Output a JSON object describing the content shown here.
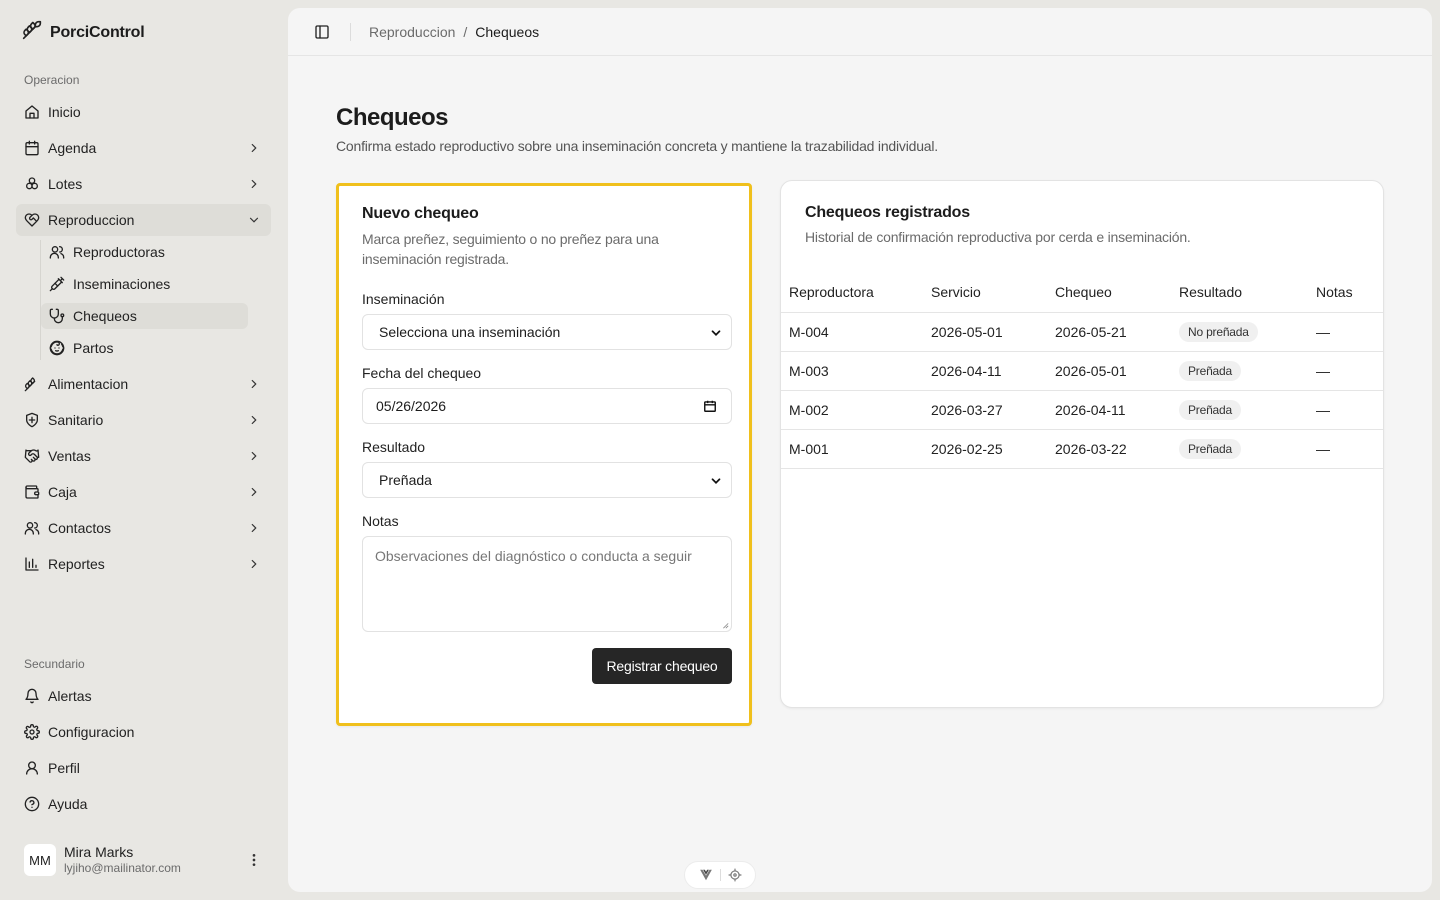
{
  "app": {
    "name": "PorciControl"
  },
  "sidebar": {
    "section_main": "Operacion",
    "items": [
      {
        "label": "Inicio",
        "icon": "home-icon"
      },
      {
        "label": "Agenda",
        "icon": "calendar-icon"
      },
      {
        "label": "Lotes",
        "icon": "boxes-icon"
      },
      {
        "label": "Reproduccion",
        "icon": "heart-handshake-icon"
      },
      {
        "label": "Alimentacion",
        "icon": "wheat-icon"
      },
      {
        "label": "Sanitario",
        "icon": "shield-icon"
      },
      {
        "label": "Ventas",
        "icon": "handshake-icon"
      },
      {
        "label": "Caja",
        "icon": "wallet-icon"
      },
      {
        "label": "Contactos",
        "icon": "users-icon"
      },
      {
        "label": "Reportes",
        "icon": "bar-chart-icon"
      }
    ],
    "subitems": [
      {
        "label": "Reproductoras",
        "icon": "users-icon"
      },
      {
        "label": "Inseminaciones",
        "icon": "syringe-icon"
      },
      {
        "label": "Chequeos",
        "icon": "stethoscope-icon"
      },
      {
        "label": "Partos",
        "icon": "baby-icon"
      }
    ],
    "section_secondary": "Secundario",
    "secondary": [
      {
        "label": "Alertas",
        "icon": "bell-icon"
      },
      {
        "label": "Configuracion",
        "icon": "gear-icon"
      },
      {
        "label": "Perfil",
        "icon": "user-icon"
      },
      {
        "label": "Ayuda",
        "icon": "help-icon"
      }
    ],
    "user": {
      "initials": "MM",
      "name": "Mira Marks",
      "email": "lyjiho@mailinator.com"
    }
  },
  "breadcrumb": {
    "parent": "Reproduccion",
    "separator": "/",
    "current": "Chequeos"
  },
  "page": {
    "title": "Chequeos",
    "description": "Confirma estado reproductivo sobre una inseminación concreta y mantiene la trazabilidad individual."
  },
  "form": {
    "title": "Nuevo chequeo",
    "description": "Marca preñez, seguimiento o no preñez para una inseminación registrada.",
    "insemination_label": "Inseminación",
    "insemination_value": "Selecciona una inseminación",
    "date_label": "Fecha del chequeo",
    "date_value": "05/26/2026",
    "result_label": "Resultado",
    "result_value": "Preñada",
    "notes_label": "Notas",
    "notes_placeholder": "Observaciones del diagnóstico o conducta a seguir",
    "submit_label": "Registrar chequeo",
    "highlight_color": "#f0c01c"
  },
  "records": {
    "title": "Chequeos registrados",
    "description": "Historial de confirmación reproductiva por cerda e inseminación.",
    "columns": [
      "Reproductora",
      "Servicio",
      "Chequeo",
      "Resultado",
      "Notas"
    ],
    "rows": [
      [
        "M-004",
        "2026-05-01",
        "2026-05-21",
        "No preñada",
        "—"
      ],
      [
        "M-003",
        "2026-04-11",
        "2026-05-01",
        "Preñada",
        "—"
      ],
      [
        "M-002",
        "2026-03-27",
        "2026-04-11",
        "Preñada",
        "—"
      ],
      [
        "M-001",
        "2026-02-25",
        "2026-03-22",
        "Preñada",
        "—"
      ]
    ]
  }
}
